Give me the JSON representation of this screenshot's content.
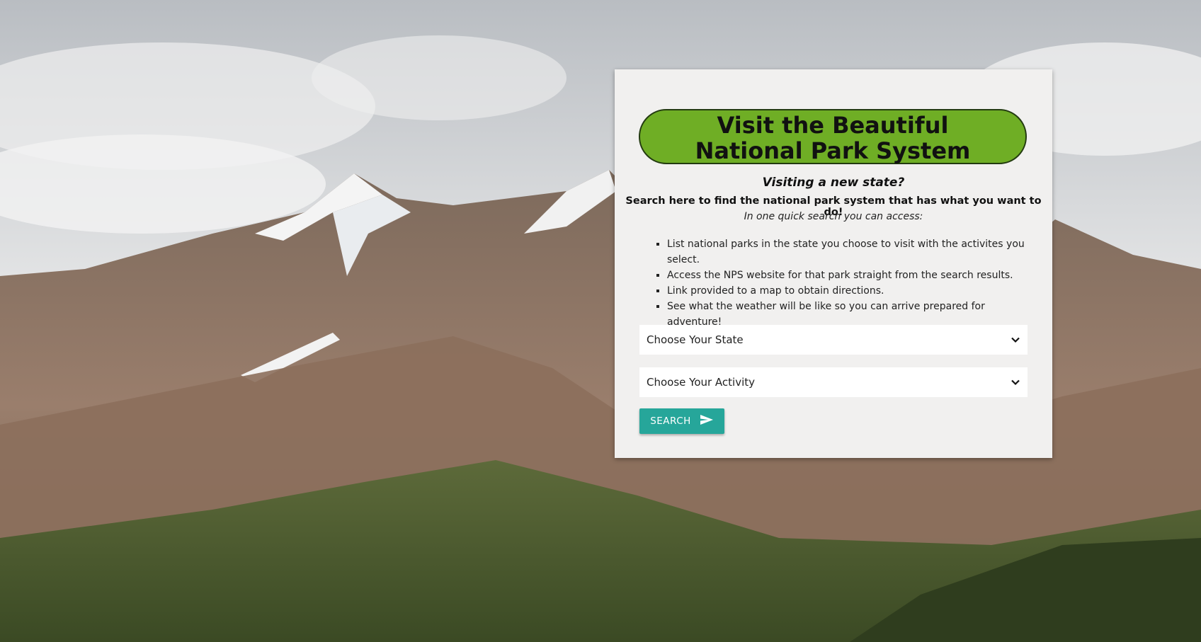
{
  "hero": {
    "title_line1": "Visit the Beautiful",
    "title_line2": "National Park System",
    "subheading": "Visiting a new state?",
    "tagline": "Search here to find the national park system that has what you want to do!",
    "intro": "In one quick search you can access:"
  },
  "features": [
    "List national parks in the state you choose to visit with the activites you select.",
    "Access the NPS website for that park straight from the search results.",
    "Link provided to a map to obtain directions.",
    "See what the weather will be like so you can arrive prepared for adventure!"
  ],
  "form": {
    "state_select": "Choose Your State",
    "activity_select": "Choose Your Activity",
    "search_label": "SEARCH"
  },
  "icons": {
    "state_chevron": "chevron-down-icon",
    "activity_chevron": "chevron-down-icon",
    "search": "send-icon"
  },
  "colors": {
    "banner": "#6fae25",
    "button": "#26a69a",
    "card": "#f1f0ef"
  }
}
